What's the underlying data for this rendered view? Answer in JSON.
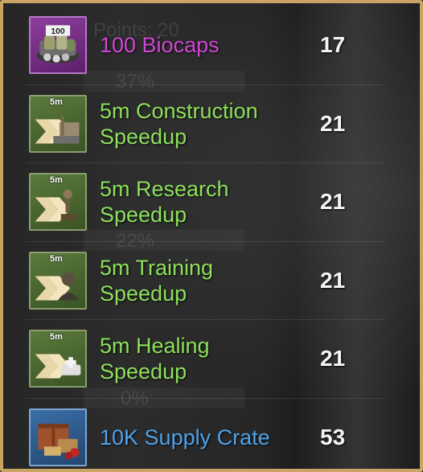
{
  "items": [
    {
      "name": "100 Biocaps",
      "count": "17",
      "color": "#d048d4",
      "icon": "biocaps-icon",
      "icon_badge": "100"
    },
    {
      "name": "5m Construction Speedup",
      "count": "21",
      "color": "#8ee05c",
      "icon": "construction-speedup-icon",
      "icon_badge": "5m"
    },
    {
      "name": "5m Research Speedup",
      "count": "21",
      "color": "#8ee05c",
      "icon": "research-speedup-icon",
      "icon_badge": "5m"
    },
    {
      "name": "5m Training Speedup",
      "count": "21",
      "color": "#8ee05c",
      "icon": "training-speedup-icon",
      "icon_badge": "5m"
    },
    {
      "name": "5m Healing Speedup",
      "count": "21",
      "color": "#8ee05c",
      "icon": "healing-speedup-icon",
      "icon_badge": "5m"
    },
    {
      "name": "10K Supply Crate",
      "count": "53",
      "color": "#4fa4ea",
      "icon": "supply-crate-icon",
      "icon_badge": ""
    }
  ],
  "background_ghost": {
    "points_text": "Points: 20",
    "percentages": [
      "37%",
      "22%",
      "0%"
    ]
  }
}
